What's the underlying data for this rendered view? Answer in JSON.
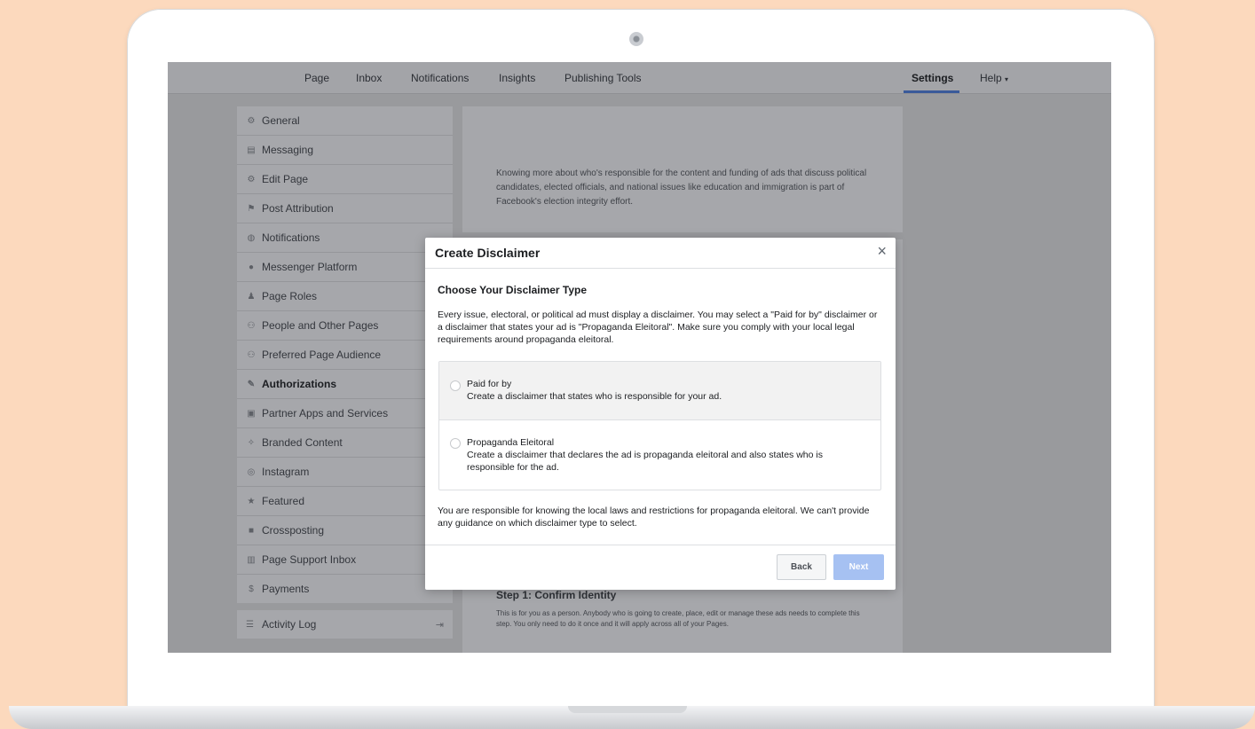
{
  "topnav": {
    "items": [
      "Page",
      "Inbox",
      "Notifications",
      "Insights",
      "Publishing Tools"
    ],
    "settings": "Settings",
    "help": "Help",
    "help_caret": "▾"
  },
  "sidebar": {
    "items": [
      {
        "label": "General",
        "icon": "gear-icon",
        "glyph": "⚙"
      },
      {
        "label": "Messaging",
        "icon": "chat-icon",
        "glyph": "▤"
      },
      {
        "label": "Edit Page",
        "icon": "gear-icon",
        "glyph": "⚙"
      },
      {
        "label": "Post Attribution",
        "icon": "flag-icon",
        "glyph": "⚑"
      },
      {
        "label": "Notifications",
        "icon": "globe-icon",
        "glyph": "◍"
      },
      {
        "label": "Messenger Platform",
        "icon": "messenger-icon",
        "glyph": "●"
      },
      {
        "label": "Page Roles",
        "icon": "person-icon",
        "glyph": "♟"
      },
      {
        "label": "People and Other Pages",
        "icon": "people-icon",
        "glyph": "⚇"
      },
      {
        "label": "Preferred Page Audience",
        "icon": "people-icon",
        "glyph": "⚇"
      },
      {
        "label": "Authorizations",
        "icon": "wrench-icon",
        "glyph": "✎",
        "active": true
      },
      {
        "label": "Partner Apps and Services",
        "icon": "apps-icon",
        "glyph": "▣"
      },
      {
        "label": "Branded Content",
        "icon": "handshake-icon",
        "glyph": "✧"
      },
      {
        "label": "Instagram",
        "icon": "instagram-icon",
        "glyph": "◎"
      },
      {
        "label": "Featured",
        "icon": "star-icon",
        "glyph": "★"
      },
      {
        "label": "Crossposting",
        "icon": "video-icon",
        "glyph": "■"
      },
      {
        "label": "Page Support Inbox",
        "icon": "inbox-icon",
        "glyph": "▥"
      },
      {
        "label": "Payments",
        "icon": "dollar-icon",
        "glyph": "$"
      }
    ],
    "activity_log": "Activity Log",
    "activity_icon": "☰",
    "activity_exit": "⇥"
  },
  "content": {
    "intro": "Knowing more about who's responsible for the content and funding of ads that discuss political candidates, elected officials, and national issues like education and immigration is part of Facebook's election integrity effort.",
    "step1_title": "Step 1: Confirm Identity",
    "step1_text": "This is for you as a person. Anybody who is going to create, place, edit or manage these ads needs to complete this step. You only need to do it once and it will apply across all of your Pages."
  },
  "modal": {
    "title": "Create Disclaimer",
    "close": "×",
    "choose_title": "Choose Your Disclaimer Type",
    "intro": "Every issue, electoral, or political ad must display a disclaimer. You may select a \"Paid for by\" disclaimer or a disclaimer that states your ad is \"Propaganda Eleitoral\". Make sure you comply with your local legal requirements around propaganda eleitoral.",
    "options": [
      {
        "label": "Paid for by",
        "desc": "Create a disclaimer that states who is responsible for your ad."
      },
      {
        "label": "Propaganda Eleitoral",
        "desc": "Create a disclaimer that declares the ad is propaganda eleitoral and also states who is responsible for the ad."
      }
    ],
    "footnote": "You are responsible for knowing the local laws and restrictions for propaganda eleitoral. We can't provide any guidance on which disclaimer type to select.",
    "back": "Back",
    "next": "Next"
  }
}
